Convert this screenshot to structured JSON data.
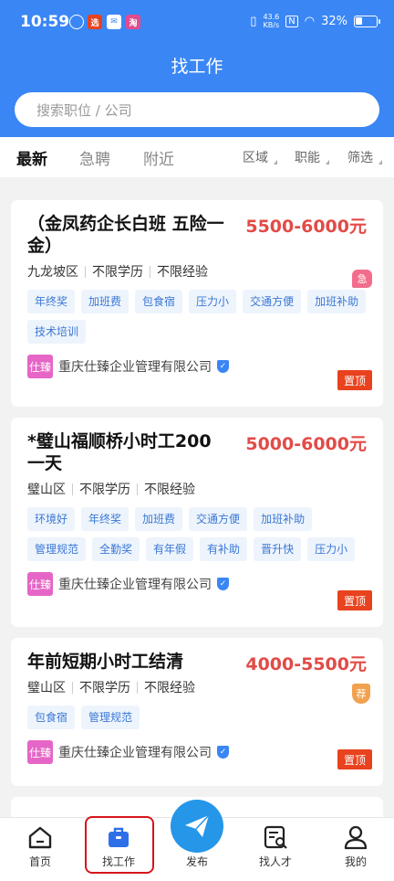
{
  "status": {
    "time": "10:59",
    "net_speed_top": "43.6",
    "net_speed_bottom": "KB/s",
    "battery": "32%",
    "battery_level": 0.32
  },
  "header": {
    "title": "找工作"
  },
  "search": {
    "placeholder": "搜索职位 / 公司"
  },
  "tabs": [
    {
      "label": "最新",
      "active": true
    },
    {
      "label": "急聘",
      "active": false
    },
    {
      "label": "附近",
      "active": false
    }
  ],
  "filters": [
    "区域",
    "职能",
    "筛选"
  ],
  "jobs": [
    {
      "title": "（金凤药企长白班 五险一金）",
      "salary": "5500-6000元",
      "district": "九龙坡区",
      "education": "不限学历",
      "experience": "不限经验",
      "badge": "急",
      "tags": [
        "年终奖",
        "加班费",
        "包食宿",
        "压力小",
        "交通方便",
        "加班补助",
        "技术培训"
      ],
      "company_logo": "仕臻",
      "company": "重庆仕臻企业管理有限公司",
      "pin": "置顶"
    },
    {
      "title": "*璧山福顺桥小时工200一天",
      "salary": "5000-6000元",
      "district": "璧山区",
      "education": "不限学历",
      "experience": "不限经验",
      "badge": "",
      "tags": [
        "环境好",
        "年终奖",
        "加班费",
        "交通方便",
        "加班补助",
        "管理规范",
        "全勤奖",
        "有年假",
        "有补助",
        "晋升快",
        "压力小"
      ],
      "company_logo": "仕臻",
      "company": "重庆仕臻企业管理有限公司",
      "pin": "置顶"
    },
    {
      "title": "年前短期小时工结清",
      "salary": "4000-5500元",
      "district": "璧山区",
      "education": "不限学历",
      "experience": "不限经验",
      "badge": "荐",
      "tags": [
        "包食宿",
        "管理规范"
      ],
      "company_logo": "仕臻",
      "company": "重庆仕臻企业管理有限公司",
      "pin": "置顶"
    }
  ],
  "nav": [
    {
      "label": "首页",
      "icon": "home-icon"
    },
    {
      "label": "找工作",
      "icon": "briefcase-icon"
    },
    {
      "label": "发布",
      "icon": "paper-plane-icon"
    },
    {
      "label": "找人才",
      "icon": "talent-search-icon"
    },
    {
      "label": "我的",
      "icon": "user-icon"
    }
  ],
  "colors": {
    "primary": "#3a86f5",
    "salary": "#e24b47",
    "pin": "#e8421f",
    "tag_bg": "#eef4fc"
  }
}
